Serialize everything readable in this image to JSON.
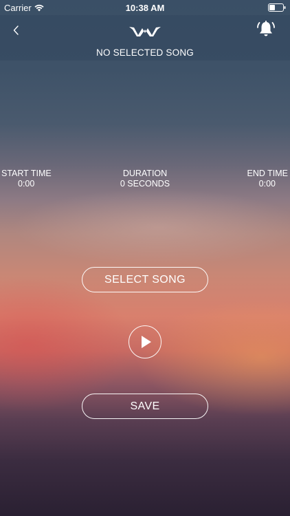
{
  "status_bar": {
    "carrier": "Carrier",
    "time": "10:38 AM"
  },
  "nav": {
    "back_icon": "chevron-left-icon",
    "logo_icon": "wave-logo-icon",
    "alarm_icon": "bell-icon",
    "title": "NO SELECTED SONG"
  },
  "timing": {
    "start_label": "START TIME",
    "start_value": "0:00",
    "duration_label": "DURATION",
    "duration_value": "0 SECONDS",
    "end_label": "END TIME",
    "end_value": "0:00"
  },
  "actions": {
    "select_song_label": "SELECT SONG",
    "play_icon": "play-icon",
    "save_label": "SAVE"
  },
  "colors": {
    "text": "#ffffff",
    "top_background": "#3a4f66",
    "bottom_background": "#2a2032",
    "sunset_accent": "#d9806d"
  }
}
